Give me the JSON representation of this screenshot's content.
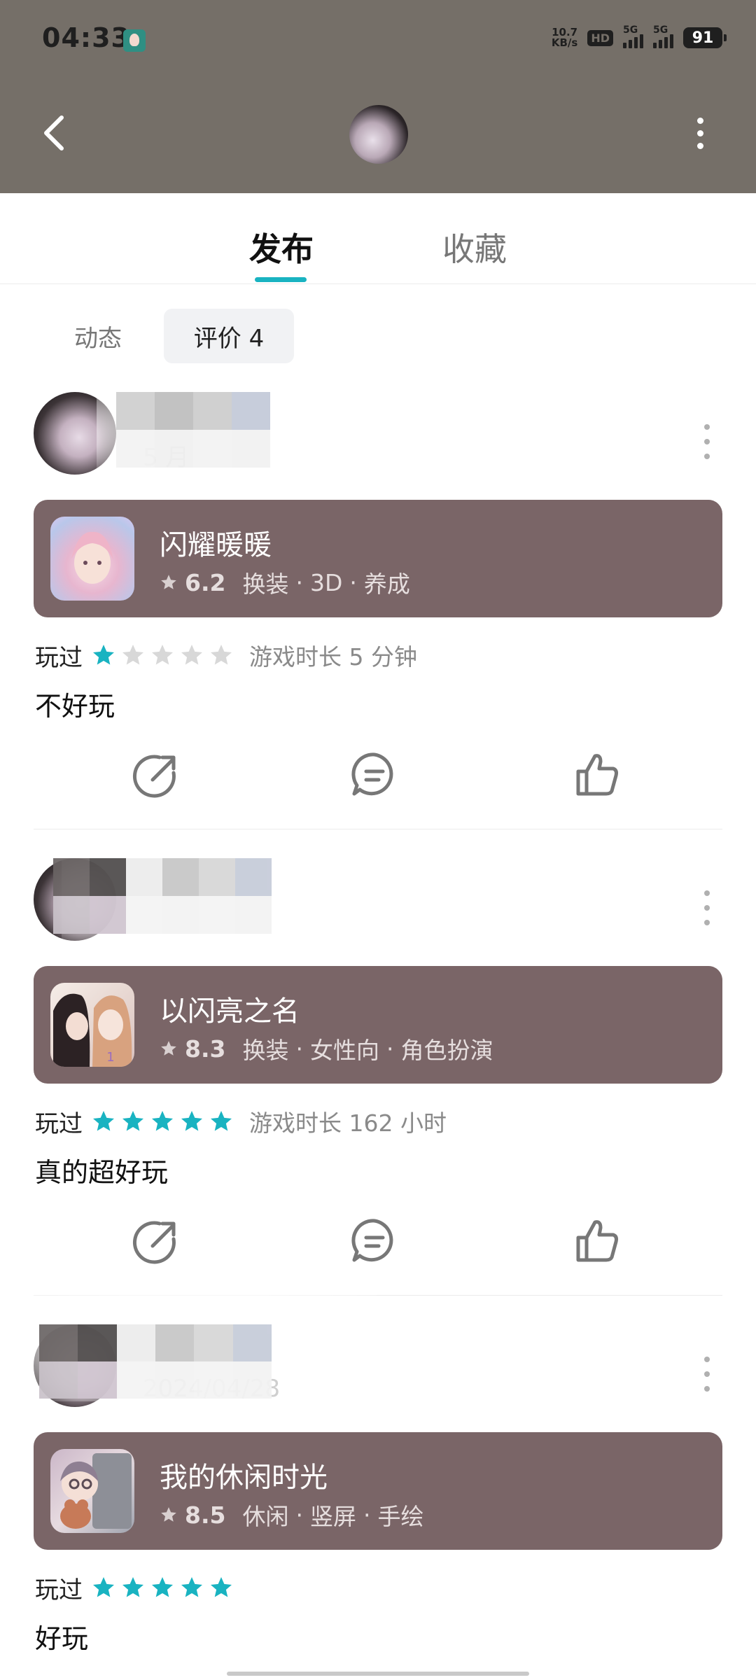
{
  "status_bar": {
    "time": "04:33",
    "net_speed_value": "10.7",
    "net_speed_unit": "KB/s",
    "hd_label": "HD",
    "signal1_label": "5G",
    "signal2_label": "5G",
    "battery": "91"
  },
  "tabs": {
    "publish": "发布",
    "favorite": "收藏"
  },
  "sub_tabs": {
    "dynamic": "动态",
    "reviews": "评价 4"
  },
  "reviews": [
    {
      "date": "5 月",
      "game": {
        "name": "闪耀暖暖",
        "rating": "6.2",
        "tags": [
          "换装",
          "3D",
          "养成"
        ]
      },
      "played_label": "玩过",
      "stars": 1,
      "playtime": "游戏时长 5 分钟",
      "text": "不好玩"
    },
    {
      "date": "",
      "game": {
        "name": "以闪亮之名",
        "rating": "8.3",
        "tags": [
          "换装",
          "女性向",
          "角色扮演"
        ]
      },
      "played_label": "玩过",
      "stars": 5,
      "playtime": "游戏时长 162 小时",
      "text": "真的超好玩"
    },
    {
      "date": "2024/04/28",
      "game": {
        "name": "我的休闲时光",
        "rating": "8.5",
        "tags": [
          "休闲",
          "竖屏",
          "手绘"
        ]
      },
      "played_label": "玩过",
      "stars": 5,
      "playtime": "",
      "text": "好玩"
    }
  ],
  "colors": {
    "header_bg": "#756f68",
    "accent": "#19b3c1",
    "game_box_bg": "#7a6567",
    "star_empty": "#d8d8d8"
  },
  "icons": {
    "back": "chevron-left-icon",
    "more": "more-vertical-icon",
    "share": "share-icon",
    "comment": "comment-icon",
    "like": "thumbs-up-icon",
    "star": "star-icon"
  }
}
